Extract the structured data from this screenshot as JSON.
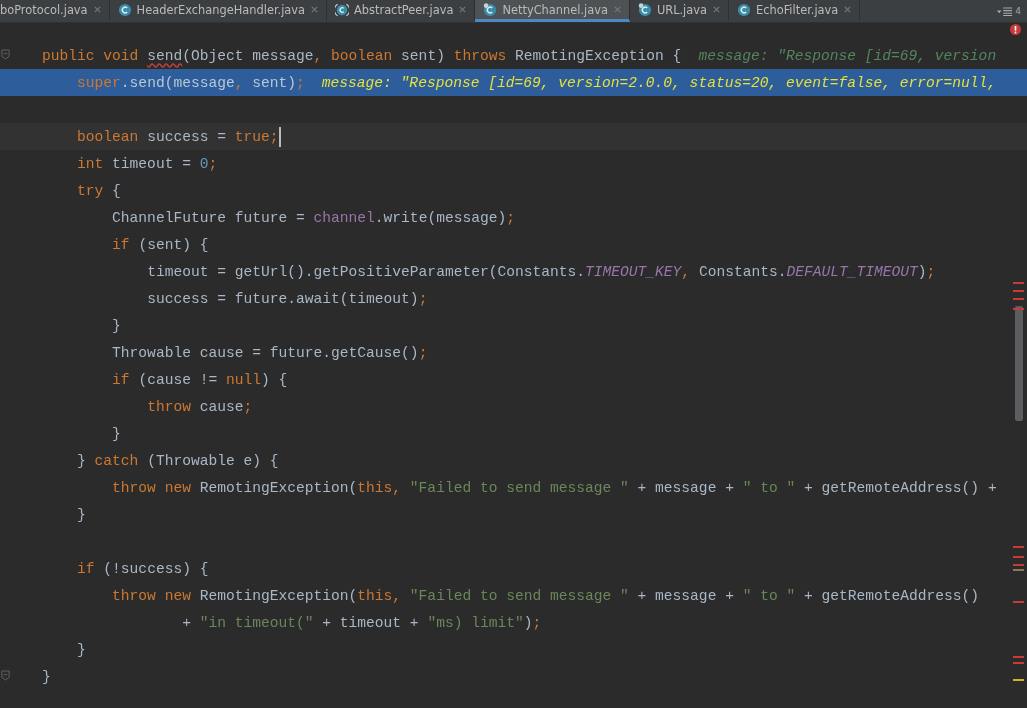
{
  "tabs": [
    {
      "label": "boProtocol.java",
      "selected": false,
      "kind": "plain"
    },
    {
      "label": "HeaderExchangeHandler.java",
      "selected": false,
      "kind": "class"
    },
    {
      "label": "AbstractPeer.java",
      "selected": false,
      "kind": "abstract"
    },
    {
      "label": "NettyChannel.java",
      "selected": true,
      "kind": "class_marked"
    },
    {
      "label": "URL.java",
      "selected": false,
      "kind": "class_marked"
    },
    {
      "label": "EchoFilter.java",
      "selected": false,
      "kind": "class"
    }
  ],
  "hidden_tabs_count": "4",
  "editor": {
    "lines": [
      {
        "kind": "plain",
        "tokens": [
          {
            "kind": "kw",
            "text": "    public void "
          },
          {
            "kind": "err",
            "text": "send"
          },
          {
            "kind": "id",
            "text": "(Object message"
          },
          {
            "kind": "punct",
            "text": ", "
          },
          {
            "kind": "kw",
            "text": "boolean "
          },
          {
            "kind": "id",
            "text": "sent) "
          },
          {
            "kind": "kw",
            "text": "throws "
          },
          {
            "kind": "id",
            "text": "RemotingException {"
          }
        ],
        "hint": "message: \"Response [id=69, version"
      },
      {
        "kind": "execution",
        "tokens": [
          {
            "kind": "kw",
            "text": "        super"
          },
          {
            "kind": "id",
            "text": ".send(message"
          },
          {
            "kind": "punct",
            "text": ", "
          },
          {
            "kind": "id",
            "text": "sent)"
          },
          {
            "kind": "punct",
            "text": ";"
          }
        ],
        "hint": "message: \"Response [id=69, version=2.0.0, status=20, event=false, error=null,"
      },
      {
        "kind": "plain"
      },
      {
        "kind": "current",
        "tokens": [
          {
            "kind": "kw",
            "text": "        boolean "
          },
          {
            "kind": "id",
            "text": "success = "
          },
          {
            "kind": "kw",
            "text": "true"
          },
          {
            "kind": "punct",
            "text": ";"
          }
        ]
      },
      {
        "kind": "plain",
        "tokens": [
          {
            "kind": "kw",
            "text": "        int "
          },
          {
            "kind": "id",
            "text": "timeout = "
          },
          {
            "kind": "num",
            "text": "0"
          },
          {
            "kind": "punct",
            "text": ";"
          }
        ]
      },
      {
        "kind": "plain",
        "tokens": [
          {
            "kind": "kw",
            "text": "        try "
          },
          {
            "kind": "id",
            "text": "{"
          }
        ]
      },
      {
        "kind": "plain",
        "tokens": [
          {
            "kind": "id",
            "text": "            ChannelFuture future = "
          },
          {
            "kind": "field",
            "text": "channel"
          },
          {
            "kind": "id",
            "text": ".write(message)"
          },
          {
            "kind": "punct",
            "text": ";"
          }
        ]
      },
      {
        "kind": "plain",
        "tokens": [
          {
            "kind": "kw",
            "text": "            if "
          },
          {
            "kind": "id",
            "text": "(sent) {"
          }
        ]
      },
      {
        "kind": "plain",
        "tokens": [
          {
            "kind": "id",
            "text": "                timeout = getUrl().getPositiveParameter(Constants."
          },
          {
            "kind": "const",
            "text": "TIMEOUT_KEY"
          },
          {
            "kind": "punct",
            "text": ", "
          },
          {
            "kind": "id",
            "text": "Constants."
          },
          {
            "kind": "const",
            "text": "DEFAULT_TIMEOUT"
          },
          {
            "kind": "id",
            "text": ")"
          },
          {
            "kind": "punct",
            "text": ";"
          }
        ]
      },
      {
        "kind": "plain",
        "tokens": [
          {
            "kind": "id",
            "text": "                success = future.await(timeout)"
          },
          {
            "kind": "punct",
            "text": ";"
          }
        ]
      },
      {
        "kind": "plain",
        "tokens": [
          {
            "kind": "id",
            "text": "            }"
          }
        ]
      },
      {
        "kind": "plain",
        "tokens": [
          {
            "kind": "id",
            "text": "            Throwable cause = future.getCause()"
          },
          {
            "kind": "punct",
            "text": ";"
          }
        ]
      },
      {
        "kind": "plain",
        "tokens": [
          {
            "kind": "kw",
            "text": "            if "
          },
          {
            "kind": "id",
            "text": "(cause != "
          },
          {
            "kind": "kw",
            "text": "null"
          },
          {
            "kind": "id",
            "text": ") {"
          }
        ]
      },
      {
        "kind": "plain",
        "tokens": [
          {
            "kind": "kw",
            "text": "                throw "
          },
          {
            "kind": "id",
            "text": "cause"
          },
          {
            "kind": "punct",
            "text": ";"
          }
        ]
      },
      {
        "kind": "plain",
        "tokens": [
          {
            "kind": "id",
            "text": "            }"
          }
        ]
      },
      {
        "kind": "plain",
        "tokens": [
          {
            "kind": "id",
            "text": "        } "
          },
          {
            "kind": "kw",
            "text": "catch "
          },
          {
            "kind": "id",
            "text": "(Throwable e) {"
          }
        ]
      },
      {
        "kind": "plain",
        "tokens": [
          {
            "kind": "kw",
            "text": "            throw new "
          },
          {
            "kind": "id",
            "text": "RemotingException("
          },
          {
            "kind": "kw",
            "text": "this"
          },
          {
            "kind": "punct",
            "text": ", "
          },
          {
            "kind": "str",
            "text": "\"Failed to send message \""
          },
          {
            "kind": "id",
            "text": " + message + "
          },
          {
            "kind": "str",
            "text": "\" to \""
          },
          {
            "kind": "id",
            "text": " + getRemoteAddress() +"
          }
        ]
      },
      {
        "kind": "plain",
        "tokens": [
          {
            "kind": "id",
            "text": "        }"
          }
        ]
      },
      {
        "kind": "plain"
      },
      {
        "kind": "plain",
        "tokens": [
          {
            "kind": "kw",
            "text": "        if "
          },
          {
            "kind": "id",
            "text": "(!success) {"
          }
        ]
      },
      {
        "kind": "plain",
        "tokens": [
          {
            "kind": "kw",
            "text": "            throw new "
          },
          {
            "kind": "id",
            "text": "RemotingException("
          },
          {
            "kind": "kw",
            "text": "this"
          },
          {
            "kind": "punct",
            "text": ", "
          },
          {
            "kind": "str",
            "text": "\"Failed to send message \""
          },
          {
            "kind": "id",
            "text": " + message + "
          },
          {
            "kind": "str",
            "text": "\" to \""
          },
          {
            "kind": "id",
            "text": " + getRemoteAddress()"
          }
        ]
      },
      {
        "kind": "plain",
        "tokens": [
          {
            "kind": "id",
            "text": "                    + "
          },
          {
            "kind": "str",
            "text": "\"in timeout(\""
          },
          {
            "kind": "id",
            "text": " + timeout + "
          },
          {
            "kind": "str",
            "text": "\"ms) limit\""
          },
          {
            "kind": "id",
            "text": ")"
          },
          {
            "kind": "punct",
            "text": ";"
          }
        ]
      },
      {
        "kind": "plain",
        "tokens": [
          {
            "kind": "id",
            "text": "        }"
          }
        ]
      },
      {
        "kind": "plain",
        "tokens": [
          {
            "kind": "id",
            "text": "    }"
          }
        ]
      }
    ]
  }
}
